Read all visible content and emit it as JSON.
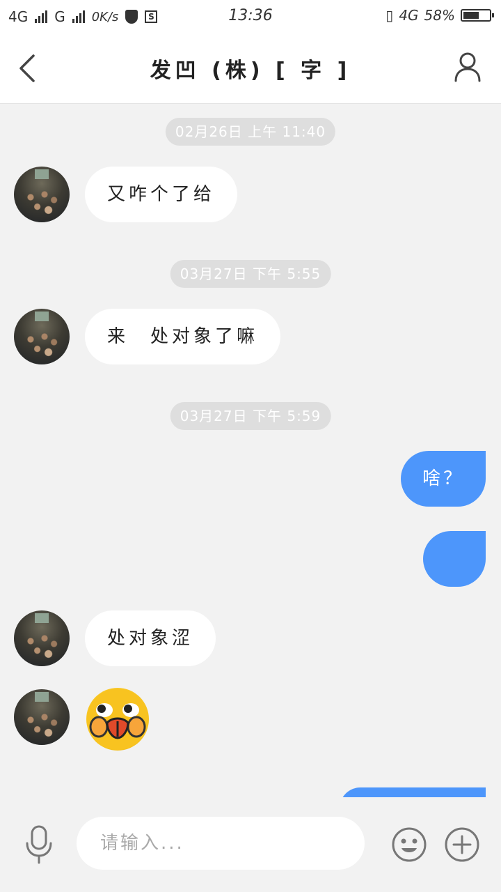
{
  "status_bar": {
    "network1": "4G",
    "network2": "G",
    "speed": "0K/s",
    "time": "13:36",
    "network3": "4G",
    "battery": "58%"
  },
  "header": {
    "title": "发凹 (株) [ 字 ]"
  },
  "messages": [
    {
      "type": "timestamp",
      "text": "02月26日 上午 11:40"
    },
    {
      "type": "incoming",
      "text": "又咋个了给"
    },
    {
      "type": "timestamp",
      "text": "03月27日 下午 5:55"
    },
    {
      "type": "incoming",
      "text": "来　处对象了嘛"
    },
    {
      "type": "timestamp",
      "text": "03月27日 下午 5:59"
    },
    {
      "type": "outgoing",
      "text": "啥？"
    },
    {
      "type": "outgoing",
      "text": ""
    },
    {
      "type": "incoming",
      "text": "处对象涩"
    },
    {
      "type": "incoming_emoji",
      "icon": "blushing-face-emoji"
    },
    {
      "type": "outgoing",
      "text": ""
    }
  ],
  "input": {
    "placeholder": "请输入..."
  },
  "colors": {
    "accent": "#4d96fb",
    "background": "#f2f2f2",
    "timestamp_bg": "#dedede"
  }
}
